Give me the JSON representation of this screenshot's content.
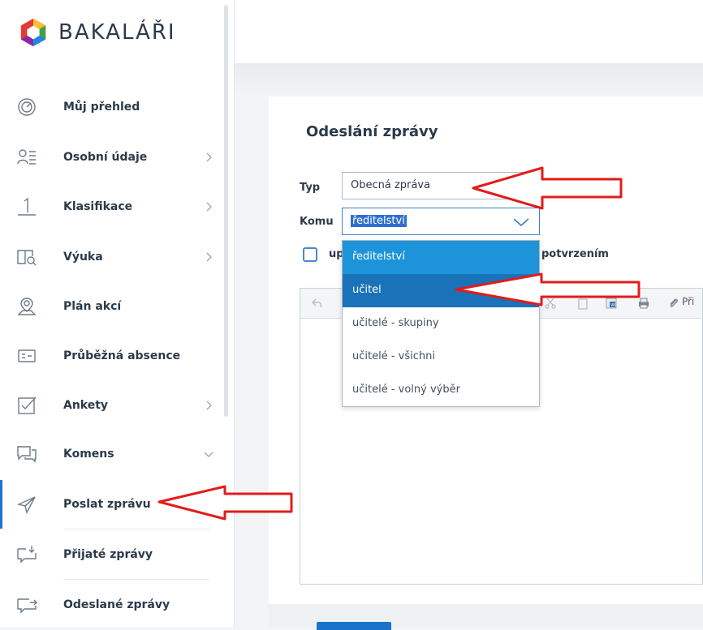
{
  "app": {
    "logo_text": "BAKALÁŘI"
  },
  "sidebar": {
    "items": [
      {
        "label": "Můj přehled",
        "icon": "dashboard-icon",
        "chevron": ""
      },
      {
        "label": "Osobní údaje",
        "icon": "person-list-icon",
        "chevron": "right"
      },
      {
        "label": "Klasifikace",
        "icon": "grade-one-icon",
        "chevron": "right"
      },
      {
        "label": "Výuka",
        "icon": "book-search-icon",
        "chevron": "right"
      },
      {
        "label": "Plán akcí",
        "icon": "map-pin-icon",
        "chevron": ""
      },
      {
        "label": "Průběžná absence",
        "icon": "absence-card-icon",
        "chevron": ""
      },
      {
        "label": "Ankety",
        "icon": "checkbox-icon",
        "chevron": "right"
      },
      {
        "label": "Komens",
        "icon": "chat-bubbles-icon",
        "chevron": "down"
      },
      {
        "label": "Poslat zprávu",
        "icon": "paper-plane-icon",
        "chevron": "",
        "active": true
      },
      {
        "label": "Přijaté zprávy",
        "icon": "inbox-icon",
        "chevron": ""
      },
      {
        "label": "Odeslané zprávy",
        "icon": "outbox-icon",
        "chevron": ""
      }
    ]
  },
  "form": {
    "title": "Odeslání zprávy",
    "typ_label": "Typ",
    "typ_value": "Obecná zpráva",
    "komu_label": "Komu",
    "komu_value": "ředitelství",
    "checkbox_prefix": "up",
    "checkbox_suffix": "potvrzením",
    "attach_label": "Při"
  },
  "dropdown": {
    "options": [
      {
        "label": "ředitelství",
        "state": "hover"
      },
      {
        "label": "učitel",
        "state": "selected"
      },
      {
        "label": "učitelé - skupiny",
        "state": ""
      },
      {
        "label": "učitelé - všichni",
        "state": ""
      },
      {
        "label": "učitelé - volný výběr",
        "state": ""
      }
    ]
  },
  "colors": {
    "accent": "#1976d2",
    "arrow": "#e31b1b",
    "option_hover": "#1d93d9",
    "option_selected": "#1a72b8"
  }
}
